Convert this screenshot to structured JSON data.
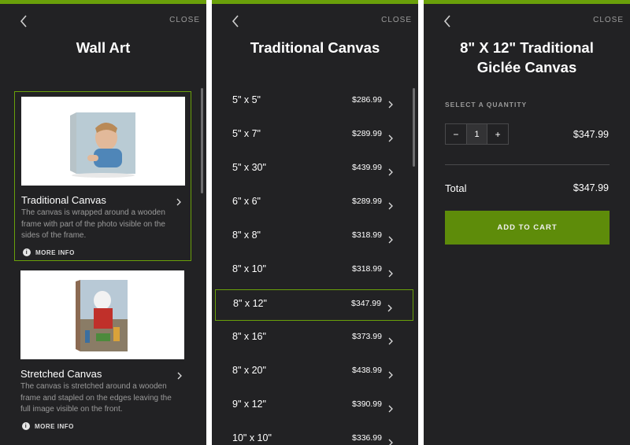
{
  "common": {
    "close_label": "CLOSE",
    "accent": "#6aa00a",
    "bg": "#222224"
  },
  "panel1": {
    "title": "Wall Art",
    "cards": [
      {
        "title": "Traditional Canvas",
        "description": "The canvas is wrapped around a wooden frame with part of the photo visible on the sides of the frame.",
        "more_info": "MORE INFO",
        "selected": true
      },
      {
        "title": "Stretched Canvas",
        "description": "The canvas is stretched around a wooden frame and stapled on the edges leaving the full image visible on the front.",
        "more_info": "MORE INFO",
        "selected": false
      }
    ]
  },
  "panel2": {
    "title": "Traditional Canvas",
    "sizes": [
      {
        "label": "5\" x 5\"",
        "price": "$286.99"
      },
      {
        "label": "5\" x 7\"",
        "price": "$289.99"
      },
      {
        "label": "5\" x 30\"",
        "price": "$439.99"
      },
      {
        "label": "6\" x 6\"",
        "price": "$289.99"
      },
      {
        "label": "8\" x 8\"",
        "price": "$318.99"
      },
      {
        "label": "8\" x 10\"",
        "price": "$318.99"
      },
      {
        "label": "8\" x 12\"",
        "price": "$347.99",
        "selected": true
      },
      {
        "label": "8\" x 16\"",
        "price": "$373.99"
      },
      {
        "label": "8\" x 20\"",
        "price": "$438.99"
      },
      {
        "label": "9\" x 12\"",
        "price": "$390.99"
      },
      {
        "label": "10\" x 10\"",
        "price": "$336.99"
      }
    ]
  },
  "panel3": {
    "title_line1": "8\" X 12\" Traditional",
    "title_line2": "Giclée Canvas",
    "quantity_label": "SELECT A QUANTITY",
    "quantity": "1",
    "minus": "−",
    "plus": "+",
    "line_price": "$347.99",
    "total_label": "Total",
    "total_value": "$347.99",
    "add_to_cart": "ADD TO CART"
  }
}
